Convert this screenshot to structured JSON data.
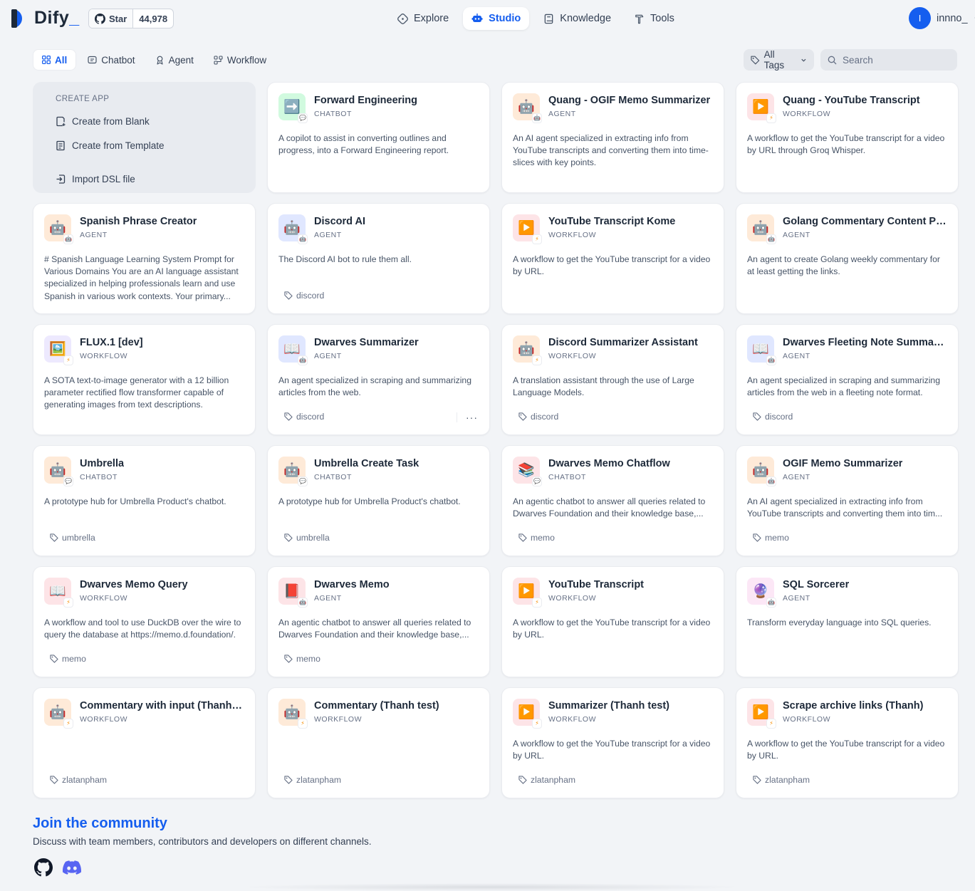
{
  "header": {
    "logo_text": "Dify",
    "github": {
      "star_label": "Star",
      "star_count": "44,978"
    },
    "nav": [
      {
        "label": "Explore",
        "icon": "compass-icon"
      },
      {
        "label": "Studio",
        "icon": "robot-icon"
      },
      {
        "label": "Knowledge",
        "icon": "book-icon"
      },
      {
        "label": "Tools",
        "icon": "hammer-icon"
      }
    ],
    "user": {
      "avatar_initial": "I",
      "name": "innno_"
    }
  },
  "filters": {
    "tabs": [
      "All",
      "Chatbot",
      "Agent",
      "Workflow"
    ],
    "active_tab": "All",
    "tags_label": "All Tags",
    "search_placeholder": "Search"
  },
  "create_app": {
    "title": "CREATE APP",
    "blank": "Create from Blank",
    "template": "Create from Template",
    "import": "Import DSL file"
  },
  "apps": [
    {
      "name": "Forward Engineering",
      "mode": "CHATBOT",
      "icon": "➡️",
      "icon_bg": "#d1fadf",
      "desc": "A copilot to assist in converting outlines and progress, into a Forward Engineering report.",
      "tag": ""
    },
    {
      "name": "Quang - OGIF Memo Summarizer",
      "mode": "AGENT",
      "icon": "🤖",
      "icon_bg": "#feead8",
      "desc": "An AI agent specialized in extracting info from YouTube transcripts and converting them into time-slices with key points.",
      "tag": ""
    },
    {
      "name": "Quang - YouTube Transcript",
      "mode": "WORKFLOW",
      "icon": "▶️",
      "icon_bg": "#fde4e7",
      "desc": "A workflow to get the YouTube transcript for a video by URL through Groq Whisper.",
      "tag": ""
    },
    {
      "name": "Spanish Phrase Creator",
      "mode": "AGENT",
      "icon": "🤖",
      "icon_bg": "#feead8",
      "desc": "# Spanish Language Learning System Prompt for Various Domains You are an AI language assistant specialized in helping professionals learn and use Spanish in various work contexts. Your primary...",
      "tag": ""
    },
    {
      "name": "Discord AI",
      "mode": "AGENT",
      "icon": "🤖",
      "icon_bg": "#e0e7ff",
      "desc": "The Discord AI bot to rule them all.",
      "tag": "discord"
    },
    {
      "name": "YouTube Transcript Kome",
      "mode": "WORKFLOW",
      "icon": "▶️",
      "icon_bg": "#fde4e7",
      "desc": "A workflow to get the YouTube transcript for a video by URL.",
      "tag": ""
    },
    {
      "name": "Golang Commentary Content Pro...",
      "mode": "AGENT",
      "icon": "🤖",
      "icon_bg": "#feead8",
      "desc": "An agent to create Golang weekly commentary for at least getting the links.",
      "tag": ""
    },
    {
      "name": "FLUX.1 [dev]",
      "mode": "WORKFLOW",
      "icon": "🖼️",
      "icon_bg": "#ede9fe",
      "desc": "A SOTA text-to-image generator with a 12 billion parameter rectified flow transformer capable of generating images from text descriptions.",
      "tag": ""
    },
    {
      "name": "Dwarves Summarizer",
      "mode": "AGENT",
      "icon": "📖",
      "icon_bg": "#e0e7ff",
      "desc": "An agent specialized in scraping and summarizing articles from the web.",
      "tag": "discord",
      "more": "···"
    },
    {
      "name": "Discord Summarizer Assistant",
      "mode": "WORKFLOW",
      "icon": "🤖",
      "icon_bg": "#feead8",
      "desc": "A translation assistant through the use of Large Language Models.",
      "tag": "discord"
    },
    {
      "name": "Dwarves Fleeting Note Summarizer",
      "mode": "AGENT",
      "icon": "📖",
      "icon_bg": "#e0e7ff",
      "desc": "An agent specialized in scraping and summarizing articles from the web in a fleeting note format.",
      "tag": "discord"
    },
    {
      "name": "Umbrella",
      "mode": "CHATBOT",
      "icon": "🤖",
      "icon_bg": "#feead8",
      "desc": "A prototype hub for Umbrella Product's chatbot.",
      "tag": "umbrella"
    },
    {
      "name": "Umbrella Create Task",
      "mode": "CHATBOT",
      "icon": "🤖",
      "icon_bg": "#feead8",
      "desc": "A prototype hub for Umbrella Product's chatbot.",
      "tag": "umbrella"
    },
    {
      "name": "Dwarves Memo Chatflow",
      "mode": "CHATBOT",
      "icon": "📚",
      "icon_bg": "#fde4e7",
      "desc": "An agentic chatbot to answer all queries related to Dwarves Foundation and their knowledge base,...",
      "tag": "memo"
    },
    {
      "name": "OGIF Memo Summarizer",
      "mode": "AGENT",
      "icon": "🤖",
      "icon_bg": "#feead8",
      "desc": "An AI agent specialized in extracting info from YouTube transcripts and converting them into tim...",
      "tag": "memo"
    },
    {
      "name": "Dwarves Memo Query",
      "mode": "WORKFLOW",
      "icon": "📖",
      "icon_bg": "#fde4e7",
      "desc": "A workflow and tool to use DuckDB over the wire to query the database at https://memo.d.foundation/.",
      "tag": "memo"
    },
    {
      "name": "Dwarves Memo",
      "mode": "AGENT",
      "icon": "📕",
      "icon_bg": "#fde4e7",
      "desc": "An agentic chatbot to answer all queries related to Dwarves Foundation and their knowledge base,...",
      "tag": "memo"
    },
    {
      "name": "YouTube Transcript",
      "mode": "WORKFLOW",
      "icon": "▶️",
      "icon_bg": "#fde4e7",
      "desc": "A workflow to get the YouTube transcript for a video by URL.",
      "tag": ""
    },
    {
      "name": "SQL Sorcerer",
      "mode": "AGENT",
      "icon": "🔮",
      "icon_bg": "#fce7f6",
      "desc": "Transform everyday language into SQL queries.",
      "tag": ""
    },
    {
      "name": "Commentary with input (Thanh te...",
      "mode": "WORKFLOW",
      "icon": "🤖",
      "icon_bg": "#feead8",
      "desc": "",
      "tag": "zlatanpham"
    },
    {
      "name": "Commentary (Thanh test)",
      "mode": "WORKFLOW",
      "icon": "🤖",
      "icon_bg": "#feead8",
      "desc": "",
      "tag": "zlatanpham"
    },
    {
      "name": "Summarizer (Thanh test)",
      "mode": "WORKFLOW",
      "icon": "▶️",
      "icon_bg": "#fde4e7",
      "desc": "A workflow to get the YouTube transcript for a video by URL.",
      "tag": "zlatanpham"
    },
    {
      "name": "Scrape archive links (Thanh)",
      "mode": "WORKFLOW",
      "icon": "▶️",
      "icon_bg": "#fde4e7",
      "desc": "A workflow to get the YouTube transcript for a video by URL.",
      "tag": "zlatanpham"
    }
  ],
  "community": {
    "title": "Join the community",
    "desc": "Discuss with team members, contributors and developers on different channels.",
    "links": [
      "github-icon",
      "discord-icon"
    ]
  },
  "colors": {
    "accent": "#155eef",
    "page_bg": "#f2f4f7",
    "card_bg": "#ffffff"
  }
}
